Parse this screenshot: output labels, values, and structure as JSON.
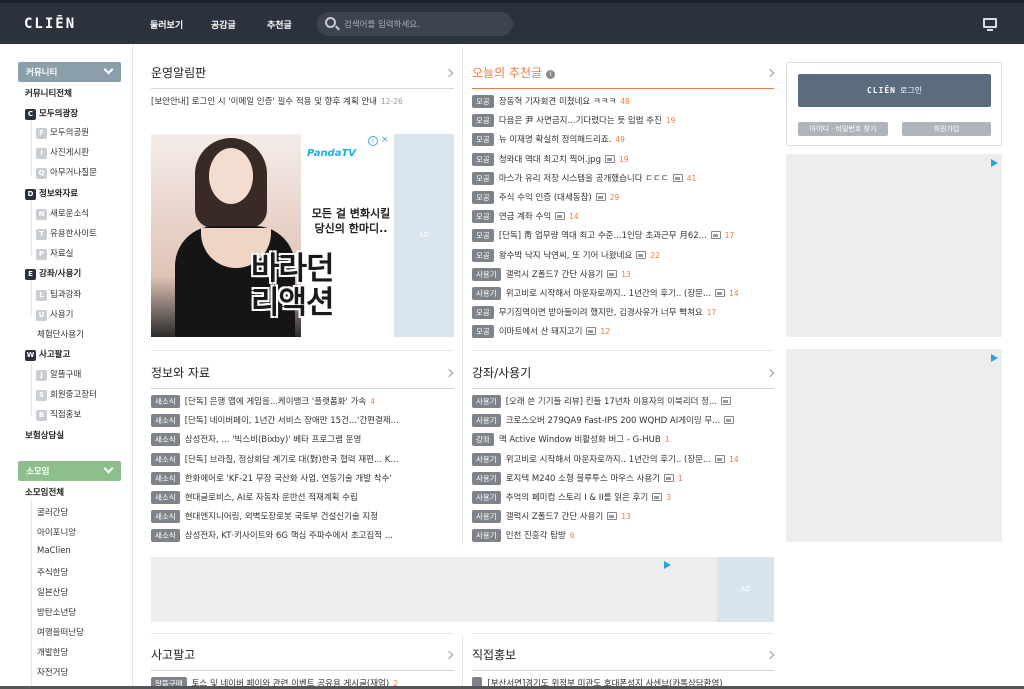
{
  "header": {
    "logo": "CLIĒN",
    "nav": [
      "둘러보기",
      "공감글",
      "추천글"
    ],
    "search_placeholder": "검색어를 입력하세요."
  },
  "sidebar": {
    "community_header": "커뮤니티",
    "community_all": "커뮤니티전체",
    "groups": [
      {
        "badge": "C",
        "label": "모두의광장",
        "subs": [
          {
            "badge": "F",
            "label": "모두의공원"
          },
          {
            "badge": "I",
            "label": "사진게시판"
          },
          {
            "badge": "Q",
            "label": "아무거나질문"
          }
        ]
      },
      {
        "badge": "D",
        "label": "정보와자료",
        "subs": [
          {
            "badge": "N",
            "label": "새로운소식"
          },
          {
            "badge": "T",
            "label": "유용한사이트"
          },
          {
            "badge": "P",
            "label": "자료실"
          }
        ]
      },
      {
        "badge": "E",
        "label": "강좌/사용기",
        "subs": [
          {
            "badge": "L",
            "label": "팁과강좌"
          },
          {
            "badge": "U",
            "label": "사용기"
          }
        ]
      },
      {
        "badge": "W",
        "label": "사고팔고",
        "subs": [
          {
            "badge": "J",
            "label": "알뜰구매"
          },
          {
            "badge": "S",
            "label": "회원중고장터"
          },
          {
            "badge": "B",
            "label": "직접홍보"
          }
        ]
      }
    ],
    "review_group": "체험단사용기",
    "insurance": "보험상담실",
    "somoim_header": "소모임",
    "somoim_all": "소모임전체",
    "somoim": [
      "굴러간당",
      "아이포니앙",
      "MaClien",
      "주식한당",
      "일본산당",
      "방탄소년당",
      "여행을떠난당",
      "개발한당",
      "자전거당"
    ]
  },
  "notice": {
    "title": "운영알림판",
    "item": "[보안안내] 로그인 시 '이메일 인증' 필수 적용 및 향후 계획 안내",
    "date": "12-26"
  },
  "ad": {
    "brand": "Panda",
    "brand_tv": "TV",
    "copy1": "모든 걸 변화시킬",
    "copy2": "당신의 한마디..",
    "big1": "바라던",
    "big2": "리액션",
    "label": "AD"
  },
  "recommend": {
    "title": "오늘의 추천글",
    "items": [
      {
        "tag": "모공",
        "text": "장동혁 기자회견 미쳤네요 ㅋㅋㅋ",
        "count": "48",
        "img": false
      },
      {
        "tag": "모공",
        "text": "다음은 尹 사면금지...기다렸다는 듯 입법 추진",
        "count": "19",
        "img": false
      },
      {
        "tag": "모공",
        "text": "뉴 이재명 확실히 정의해드리죠.",
        "count": "49",
        "img": false
      },
      {
        "tag": "모공",
        "text": "청와대 역대 최고치 찍어.jpg",
        "count": "19",
        "img": true
      },
      {
        "tag": "모공",
        "text": "마스가 유리 저장 시스템을 공개했습니다 ㄷㄷㄷ",
        "count": "41",
        "img": true
      },
      {
        "tag": "모공",
        "text": "주식 수익 인증 (대세동참)",
        "count": "29",
        "img": true
      },
      {
        "tag": "모공",
        "text": "연금 계좌 수익",
        "count": "14",
        "img": true
      },
      {
        "tag": "모공",
        "text": "[단독] 靑 업무량 역대 최고 수준...1인당 초과근무 月62...",
        "count": "17",
        "img": true
      },
      {
        "tag": "모공",
        "text": "왕수박 낙지 낙연씨, 또 기어 나왔네요",
        "count": "22",
        "img": true
      },
      {
        "tag": "사용기",
        "text": "갤럭시 Z폴드7 간단 사용기",
        "count": "13",
        "img": true
      },
      {
        "tag": "사용기",
        "text": "위고비로 시작해서 마운자로까지.. 1년간의 후기.. (장문...",
        "count": "14",
        "img": true
      },
      {
        "tag": "모공",
        "text": "무기징역이면 받아들이려 했지만, 김경사유가 너무 빡쳐요",
        "count": "17",
        "img": false
      },
      {
        "tag": "모공",
        "text": "이마트에서 산 돼지고기",
        "count": "12",
        "img": true
      }
    ]
  },
  "info": {
    "title": "정보와 자료",
    "items": [
      {
        "tag": "새소식",
        "text": "[단독] 은행 앱에 게임을...케이뱅크 '플랫폼화' 가속",
        "count": "4"
      },
      {
        "tag": "새소식",
        "text": "[단독] 네이버페이, 1년간 서비스 장애만 15건...'간편결제...",
        "count": ""
      },
      {
        "tag": "새소식",
        "text": "삼성전자, ... '빅스비(Bixby)' 베타 프로그램 운영",
        "count": ""
      },
      {
        "tag": "새소식",
        "text": "[단독] 브라질, 정상회담 계기로 대(對)한국 협력 재편... K...",
        "count": ""
      },
      {
        "tag": "새소식",
        "text": "한화에어로 'KF-21 무장 국산화 사업, 연동기술 개발 착수'",
        "count": ""
      },
      {
        "tag": "새소식",
        "text": "현대글로비스, AI로 자동차 운반선 적재계획 수립",
        "count": ""
      },
      {
        "tag": "새소식",
        "text": "현대엔지니어링, 외벽도장로봇 국토부 건설신기술 지정",
        "count": ""
      },
      {
        "tag": "새소식",
        "text": "삼성전자, KT·키사이트와 6G 핵심 주파수에서 초고집적 ...",
        "count": ""
      }
    ]
  },
  "lecture": {
    "title": "강좌/사용기",
    "items": [
      {
        "tag": "사용기",
        "text": "[오래 쓴 기기들 리뷰] 킨들 17년차 이용자의 이북리더 정...",
        "count": "",
        "img": true
      },
      {
        "tag": "사용기",
        "text": "크로스오버 279QA9 Fast-IPS 200 WQHD AI게이밍 무...",
        "count": "",
        "img": true
      },
      {
        "tag": "강좌",
        "text": "맥 Active Window 비활성화 버그 - G-HUB",
        "count": "1",
        "img": false
      },
      {
        "tag": "사용기",
        "text": "위고비로 시작해서 마운자로까지.. 1년간의 후기.. (장문...",
        "count": "14",
        "img": true
      },
      {
        "tag": "사용기",
        "text": "로지텍 M240 소형 블루투스 마우스 사용기",
        "count": "1",
        "img": true
      },
      {
        "tag": "사용기",
        "text": "추억의 페미컴 스토리 I & II를 읽은 후기",
        "count": "3",
        "img": true
      },
      {
        "tag": "사용기",
        "text": "갤럭시 Z폴드7 간단 사용기",
        "count": "13",
        "img": true
      },
      {
        "tag": "사용기",
        "text": "인천 진흥각 탐방",
        "count": "6",
        "img": false
      }
    ]
  },
  "trade": {
    "title": "사고팔고",
    "item": "토스 및 네이버 페이와 관련 이벤트 공유용 게시글(재업)",
    "tag": "알뜰구매",
    "count": "2"
  },
  "promo": {
    "title": "직접홍보",
    "item": "[부산서면]경기도 위정부 미관도 호대폰성지 사센브(카톡상담환영)"
  },
  "login": {
    "button_logo": "CLIĒN",
    "button_text": "로그인",
    "find": "아이디 · 비밀번호 찾기",
    "join": "회원가입"
  },
  "ad_label": "AD",
  "colors": {
    "topbar": "#2b323d",
    "accent_orange": "#f07c3c",
    "sidebar_green": "#8cbf8c",
    "sidebar_slate": "#8a9fa9"
  }
}
